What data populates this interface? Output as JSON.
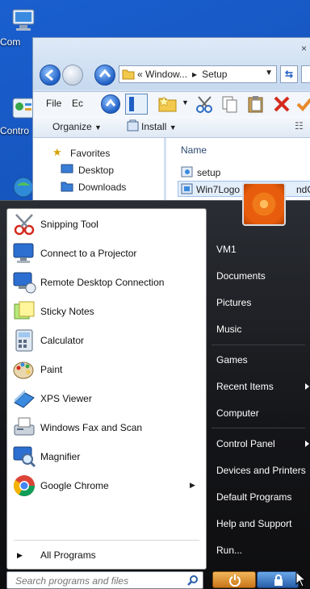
{
  "desktop": {
    "icons": [
      {
        "label": "Com",
        "icon": "computer-icon"
      },
      {
        "label": "Contro",
        "icon": "control-panel-icon"
      },
      {
        "label": "",
        "icon": "network-icon"
      }
    ]
  },
  "explorer": {
    "address": [
      "Window...",
      "Setup"
    ],
    "menu": {
      "file": "File",
      "edit": "Ec"
    },
    "commands": {
      "organize": "Organize",
      "install": "Install"
    },
    "nav": {
      "favorites": "Favorites",
      "desktop": "Desktop",
      "downloads": "Downloads"
    },
    "files": {
      "column_name": "Name",
      "items": [
        "setup",
        "Win7Logo",
        "ndCh"
      ]
    }
  },
  "start_menu": {
    "programs": [
      {
        "label": "Snipping Tool",
        "icon": "scissors-icon"
      },
      {
        "label": "Connect to a Projector",
        "icon": "projector-icon"
      },
      {
        "label": "Remote Desktop Connection",
        "icon": "remote-desktop-icon"
      },
      {
        "label": "Sticky Notes",
        "icon": "sticky-notes-icon"
      },
      {
        "label": "Calculator",
        "icon": "calculator-icon"
      },
      {
        "label": "Paint",
        "icon": "paint-palette-icon"
      },
      {
        "label": "XPS Viewer",
        "icon": "xps-viewer-icon"
      },
      {
        "label": "Windows Fax and Scan",
        "icon": "fax-scan-icon"
      },
      {
        "label": "Magnifier",
        "icon": "magnifier-icon"
      },
      {
        "label": "Google Chrome",
        "icon": "chrome-icon"
      }
    ],
    "all_programs": "All Programs",
    "search_placeholder": "Search programs and files",
    "right": {
      "user": "VM1",
      "documents": "Documents",
      "pictures": "Pictures",
      "music": "Music",
      "games": "Games",
      "recent": "Recent Items",
      "computer": "Computer",
      "control_panel": "Control Panel",
      "devices": "Devices and Printers",
      "default_programs": "Default Programs",
      "help": "Help and Support",
      "run": "Run..."
    }
  },
  "colors": {
    "desktop_blue": "#1a5fd0",
    "start_dark": "#141518",
    "power_orange": "#e59a3a"
  }
}
